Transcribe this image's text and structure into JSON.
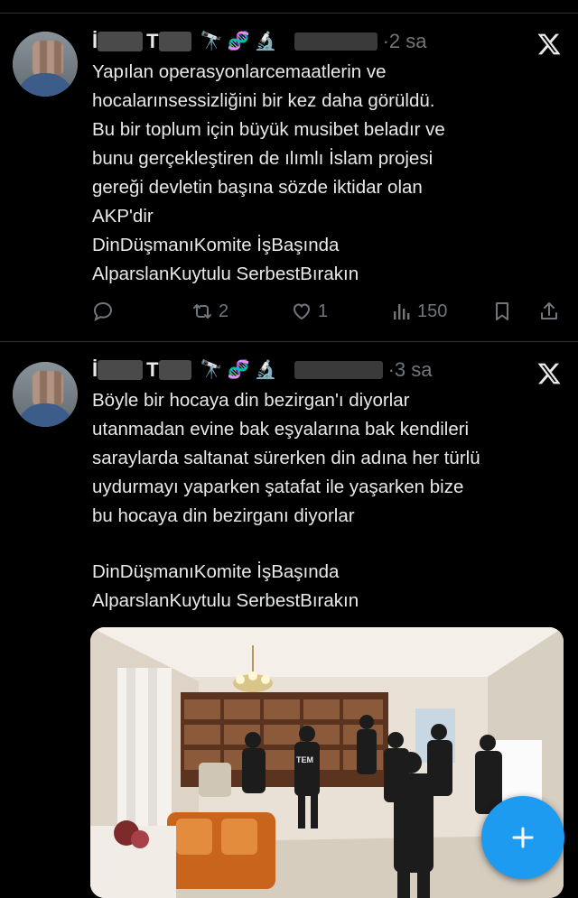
{
  "tweets": [
    {
      "name_initial_1": "İ",
      "name_initial_2": "T",
      "time": "·2 sa",
      "lines": [
        "Yapılan operasyonlarcemaatlerin ve",
        "hocalarınsessizliğini bir kez daha görüldü.",
        "Bu bir toplum için büyük musibet beladır ve",
        "bunu gerçekleştiren de  ılımlı İslam projesi",
        "gereği devletin başına sözde iktidar olan",
        "AKP'dir",
        "DinDüşmanıKomite İşBaşında",
        "AlparslanKuytulu SerbestBırakın"
      ],
      "retweets": "2",
      "likes": "1",
      "views": "150"
    },
    {
      "name_initial_1": "İ",
      "name_initial_2": "T",
      "time": "·3 sa",
      "lines": [
        "Böyle bir hocaya din bezirgan'ı diyorlar",
        "utanmadan evine bak eşyalarına bak kendileri",
        "saraylarda saltanat sürerken din adına her türlü",
        "uydurmayı yaparken şatafat ile yaşarken bize",
        "bu hocaya din bezirganı diyorlar"
      ],
      "lines2": [
        "DinDüşmanıKomite İşBaşında",
        "AlparslanKuytulu SerbestBırakın"
      ],
      "vest_text": "TEM"
    }
  ],
  "icons": {
    "emoji_1": "telescope-icon",
    "emoji_2": "dna-icon",
    "emoji_3": "microscope-icon",
    "close": "x-logo-icon",
    "reply": "reply-icon",
    "retweet": "retweet-icon",
    "like": "heart-icon",
    "views": "views-icon",
    "bookmark": "bookmark-icon",
    "share": "share-icon",
    "compose": "plus-icon"
  },
  "colors": {
    "background": "#000000",
    "text": "#e7e9ea",
    "muted": "#71767b",
    "accent": "#1d9bf0"
  }
}
